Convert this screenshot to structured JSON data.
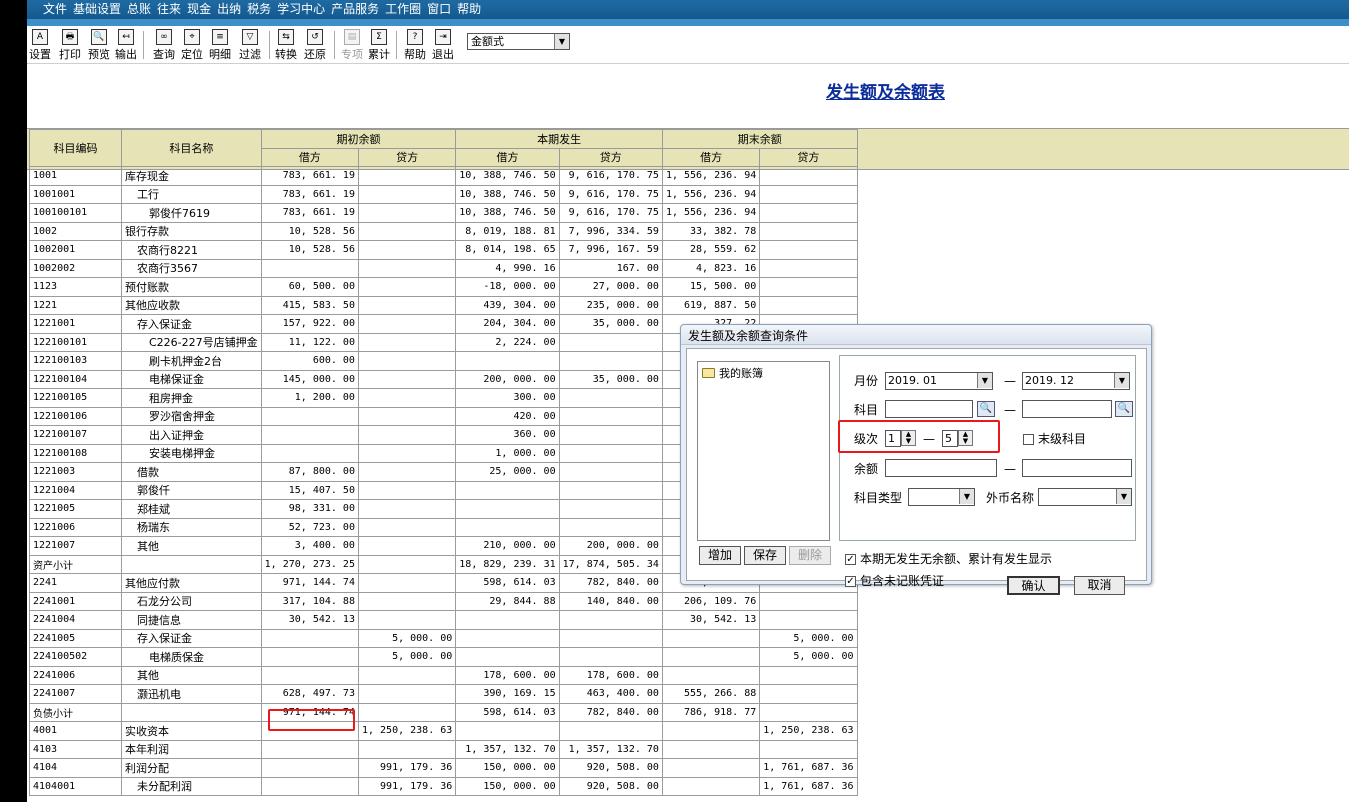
{
  "menu": {
    "items": [
      "文件",
      "基础设置",
      "总账",
      "往来",
      "现金",
      "出纳",
      "税务",
      "学习中心",
      "产品服务",
      "工作圈",
      "窗口",
      "帮助"
    ]
  },
  "toolbar": {
    "buttons": [
      {
        "label": "设置",
        "icon": "settings-icon",
        "glyph": "A"
      },
      {
        "label": "打印",
        "icon": "print-icon",
        "glyph": "🖶"
      },
      {
        "label": "预览",
        "icon": "preview-icon",
        "glyph": "🔍"
      },
      {
        "label": "输出",
        "icon": "export-icon",
        "glyph": "↤"
      },
      {
        "label": "查询",
        "icon": "binoculars-icon",
        "glyph": "∞"
      },
      {
        "label": "定位",
        "icon": "locate-icon",
        "glyph": "⌖"
      },
      {
        "label": "明细",
        "icon": "detail-icon",
        "glyph": "≡"
      },
      {
        "label": "过滤",
        "icon": "filter-icon",
        "glyph": "▽"
      },
      {
        "label": "转换",
        "icon": "convert-icon",
        "glyph": "⇆"
      },
      {
        "label": "还原",
        "icon": "restore-icon",
        "glyph": "↺"
      },
      {
        "label": "专项",
        "icon": "special-icon",
        "glyph": "▤"
      },
      {
        "label": "累计",
        "icon": "sum-icon",
        "glyph": "Σ"
      },
      {
        "label": "帮助",
        "icon": "help-icon",
        "glyph": "?"
      },
      {
        "label": "退出",
        "icon": "exit-icon",
        "glyph": "⇥"
      }
    ],
    "format_select": "金额式"
  },
  "report": {
    "title": "发生额及余额表"
  },
  "table": {
    "headers": {
      "code": "科目编码",
      "name": "科目名称",
      "opening": "期初余额",
      "period": "本期发生",
      "closing": "期末余额",
      "debit": "借方",
      "credit": "贷方"
    },
    "rows": [
      {
        "code": "1001",
        "name": "库存现金",
        "lvl": 0,
        "od": "783, 661. 19",
        "oc": "",
        "pd": "10, 388, 746. 50",
        "pc": "9, 616, 170. 75",
        "cd": "1, 556, 236. 94",
        "cc": ""
      },
      {
        "code": "1001001",
        "name": "工行",
        "lvl": 1,
        "od": "783, 661. 19",
        "oc": "",
        "pd": "10, 388, 746. 50",
        "pc": "9, 616, 170. 75",
        "cd": "1, 556, 236. 94",
        "cc": ""
      },
      {
        "code": "100100101",
        "name": "郭俊仟7619",
        "lvl": 2,
        "od": "783, 661. 19",
        "oc": "",
        "pd": "10, 388, 746. 50",
        "pc": "9, 616, 170. 75",
        "cd": "1, 556, 236. 94",
        "cc": ""
      },
      {
        "code": "1002",
        "name": "银行存款",
        "lvl": 0,
        "od": "10, 528. 56",
        "oc": "",
        "pd": "8, 019, 188. 81",
        "pc": "7, 996, 334. 59",
        "cd": "33, 382. 78",
        "cc": ""
      },
      {
        "code": "1002001",
        "name": "农商行8221",
        "lvl": 1,
        "od": "10, 528. 56",
        "oc": "",
        "pd": "8, 014, 198. 65",
        "pc": "7, 996, 167. 59",
        "cd": "28, 559. 62",
        "cc": ""
      },
      {
        "code": "1002002",
        "name": "农商行3567",
        "lvl": 1,
        "od": "",
        "oc": "",
        "pd": "4, 990. 16",
        "pc": "167. 00",
        "cd": "4, 823. 16",
        "cc": ""
      },
      {
        "code": "1123",
        "name": "预付账款",
        "lvl": 0,
        "od": "60, 500. 00",
        "oc": "",
        "pd": "-18, 000. 00",
        "pc": "27, 000. 00",
        "cd": "15, 500. 00",
        "cc": ""
      },
      {
        "code": "1221",
        "name": "其他应收款",
        "lvl": 0,
        "od": "415, 583. 50",
        "oc": "",
        "pd": "439, 304. 00",
        "pc": "235, 000. 00",
        "cd": "619, 887. 50",
        "cc": ""
      },
      {
        "code": "1221001",
        "name": "存入保证金",
        "lvl": 1,
        "od": "157, 922. 00",
        "oc": "",
        "pd": "204, 304. 00",
        "pc": "35, 000. 00",
        "cd": "327, 22",
        "cc": ""
      },
      {
        "code": "122100101",
        "name": "C226-227号店铺押金",
        "lvl": 2,
        "od": "11, 122. 00",
        "oc": "",
        "pd": "2, 224. 00",
        "pc": "",
        "cd": "13, 34",
        "cc": ""
      },
      {
        "code": "122100103",
        "name": "刷卡机押金2台",
        "lvl": 2,
        "od": "600. 00",
        "oc": "",
        "pd": "",
        "pc": "",
        "cd": "60",
        "cc": ""
      },
      {
        "code": "122100104",
        "name": "电梯保证金",
        "lvl": 2,
        "od": "145, 000. 00",
        "oc": "",
        "pd": "200, 000. 00",
        "pc": "35, 000. 00",
        "cd": "310, 00",
        "cc": ""
      },
      {
        "code": "122100105",
        "name": "租房押金",
        "lvl": 2,
        "od": "1, 200. 00",
        "oc": "",
        "pd": "300. 00",
        "pc": "",
        "cd": "1, 50",
        "cc": ""
      },
      {
        "code": "122100106",
        "name": "罗沙宿舍押金",
        "lvl": 2,
        "od": "",
        "oc": "",
        "pd": "420. 00",
        "pc": "",
        "cd": "42",
        "cc": ""
      },
      {
        "code": "122100107",
        "name": "出入证押金",
        "lvl": 2,
        "od": "",
        "oc": "",
        "pd": "360. 00",
        "pc": "",
        "cd": "36",
        "cc": ""
      },
      {
        "code": "122100108",
        "name": "安装电梯押金",
        "lvl": 2,
        "od": "",
        "oc": "",
        "pd": "1, 000. 00",
        "pc": "",
        "cd": "1, 00",
        "cc": ""
      },
      {
        "code": "1221003",
        "name": "借款",
        "lvl": 1,
        "od": "87, 800. 00",
        "oc": "",
        "pd": "25, 000. 00",
        "pc": "",
        "cd": "112, 80",
        "cc": ""
      },
      {
        "code": "1221004",
        "name": "郭俊仟",
        "lvl": 1,
        "od": "15, 407. 50",
        "oc": "",
        "pd": "",
        "pc": "",
        "cd": "15, 40",
        "cc": ""
      },
      {
        "code": "1221005",
        "name": "郑桂斌",
        "lvl": 1,
        "od": "98, 331. 00",
        "oc": "",
        "pd": "",
        "pc": "",
        "cd": "98, 33",
        "cc": ""
      },
      {
        "code": "1221006",
        "name": "杨瑞东",
        "lvl": 1,
        "od": "52, 723. 00",
        "oc": "",
        "pd": "",
        "pc": "",
        "cd": "52, 72",
        "cc": ""
      },
      {
        "code": "1221007",
        "name": "其他",
        "lvl": 1,
        "od": "3, 400. 00",
        "oc": "",
        "pd": "210, 000. 00",
        "pc": "200, 000. 00",
        "cd": "13, 40",
        "cc": ""
      },
      {
        "code": "资产小计",
        "name": "",
        "lvl": 0,
        "od": "1, 270, 273. 25",
        "oc": "",
        "pd": "18, 829, 239. 31",
        "pc": "17, 874, 505. 34",
        "cd": "2, 225, 00",
        "cc": ""
      },
      {
        "code": "2241",
        "name": "其他应付款",
        "lvl": 0,
        "od": "971, 144. 74",
        "oc": "",
        "pd": "598, 614. 03",
        "pc": "782, 840. 00",
        "cd": "786, 918. 77",
        "cc": ""
      },
      {
        "code": "2241001",
        "name": "石龙分公司",
        "lvl": 1,
        "od": "317, 104. 88",
        "oc": "",
        "pd": "29, 844. 88",
        "pc": "140, 840. 00",
        "cd": "206, 109. 76",
        "cc": ""
      },
      {
        "code": "2241004",
        "name": "同捷信息",
        "lvl": 1,
        "od": "30, 542. 13",
        "oc": "",
        "pd": "",
        "pc": "",
        "cd": "30, 542. 13",
        "cc": ""
      },
      {
        "code": "2241005",
        "name": "存入保证金",
        "lvl": 1,
        "od": "",
        "oc": "5, 000. 00",
        "pd": "",
        "pc": "",
        "cd": "",
        "cc": "5, 000. 00"
      },
      {
        "code": "224100502",
        "name": "电梯质保金",
        "lvl": 2,
        "od": "",
        "oc": "5, 000. 00",
        "pd": "",
        "pc": "",
        "cd": "",
        "cc": "5, 000. 00"
      },
      {
        "code": "2241006",
        "name": "其他",
        "lvl": 1,
        "od": "",
        "oc": "",
        "pd": "178, 600. 00",
        "pc": "178, 600. 00",
        "cd": "",
        "cc": ""
      },
      {
        "code": "2241007",
        "name": "灏迅机电",
        "lvl": 1,
        "od": "628, 497. 73",
        "oc": "",
        "pd": "390, 169. 15",
        "pc": "463, 400. 00",
        "cd": "555, 266. 88",
        "cc": ""
      },
      {
        "code": "负债小计",
        "name": "",
        "lvl": 0,
        "od": "971, 144. 74",
        "oc": "",
        "pd": "598, 614. 03",
        "pc": "782, 840. 00",
        "cd": "786, 918. 77",
        "cc": ""
      },
      {
        "code": "4001",
        "name": "实收资本",
        "lvl": 0,
        "od": "",
        "oc": "1, 250, 238. 63",
        "pd": "",
        "pc": "",
        "cd": "",
        "cc": "1, 250, 238. 63"
      },
      {
        "code": "4103",
        "name": "本年利润",
        "lvl": 0,
        "od": "",
        "oc": "",
        "pd": "1, 357, 132. 70",
        "pc": "1, 357, 132. 70",
        "cd": "",
        "cc": ""
      },
      {
        "code": "4104",
        "name": "利润分配",
        "lvl": 0,
        "od": "",
        "oc": "991, 179. 36",
        "pd": "150, 000. 00",
        "pc": "920, 508. 00",
        "cd": "",
        "cc": "1, 761, 687. 36"
      },
      {
        "code": "4104001",
        "name": "未分配利润",
        "lvl": 1,
        "od": "",
        "oc": "991, 179. 36",
        "pd": "150, 000. 00",
        "pc": "920, 508. 00",
        "cd": "",
        "cc": "1, 761, 687. 36"
      }
    ]
  },
  "dialog": {
    "title": "发生额及余额查询条件",
    "tree_root": "我的账簿",
    "add_label": "增加",
    "save_label": "保存",
    "delete_label": "删除",
    "month_label": "月份",
    "month_from": "2019. 01",
    "month_to": "2019. 12",
    "subject_label": "科目",
    "subject_from": "",
    "subject_to": "",
    "level_label": "级次",
    "level_from": "1",
    "level_to": "5",
    "last_level_label": "末级科目",
    "last_level_checked": false,
    "balance_label": "余额",
    "balance_from": "",
    "balance_to": "",
    "subject_type_label": "科目类型",
    "subject_type": "",
    "currency_label": "外币名称",
    "currency": "",
    "dash": "—",
    "opt1_label": "本期无发生无余额、累计有发生显示",
    "opt1_checked": true,
    "opt2_label": "包含未记账凭证",
    "opt2_checked": true,
    "ok_label": "确认",
    "cancel_label": "取消"
  }
}
